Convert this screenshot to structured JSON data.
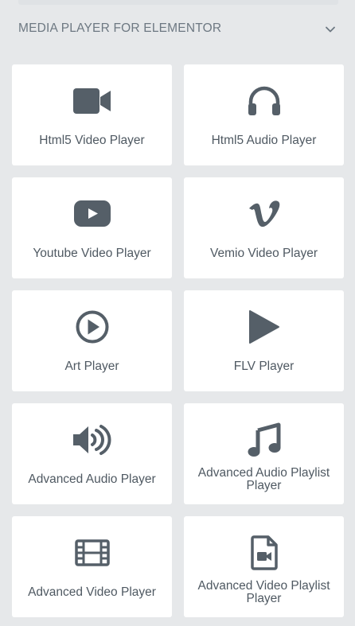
{
  "category": {
    "title": "MEDIA PLAYER FOR ELEMENTOR",
    "toggle_icon": "chevron-down-icon"
  },
  "colors": {
    "background": "#e6e8ea",
    "card": "#ffffff",
    "icon": "#555f68",
    "label": "#4f5962",
    "header_text": "#6d7882"
  },
  "widgets": [
    {
      "label": "Html5 Video Player",
      "icon": "video-camera-icon"
    },
    {
      "label": "Html5 Audio Player",
      "icon": "headphones-icon"
    },
    {
      "label": "Youtube Video Player",
      "icon": "youtube-icon"
    },
    {
      "label": "Vemio Video Player",
      "icon": "vimeo-icon"
    },
    {
      "label": "Art Player",
      "icon": "play-circle-icon"
    },
    {
      "label": "FLV Player",
      "icon": "play-icon"
    },
    {
      "label": "Advanced Audio Player",
      "icon": "volume-up-icon"
    },
    {
      "label": "Advanced Audio Playlist Player",
      "icon": "music-note-icon"
    },
    {
      "label": "Advanced Video Player",
      "icon": "film-icon"
    },
    {
      "label": "Advanced Video Playlist Player",
      "icon": "file-video-icon"
    }
  ]
}
